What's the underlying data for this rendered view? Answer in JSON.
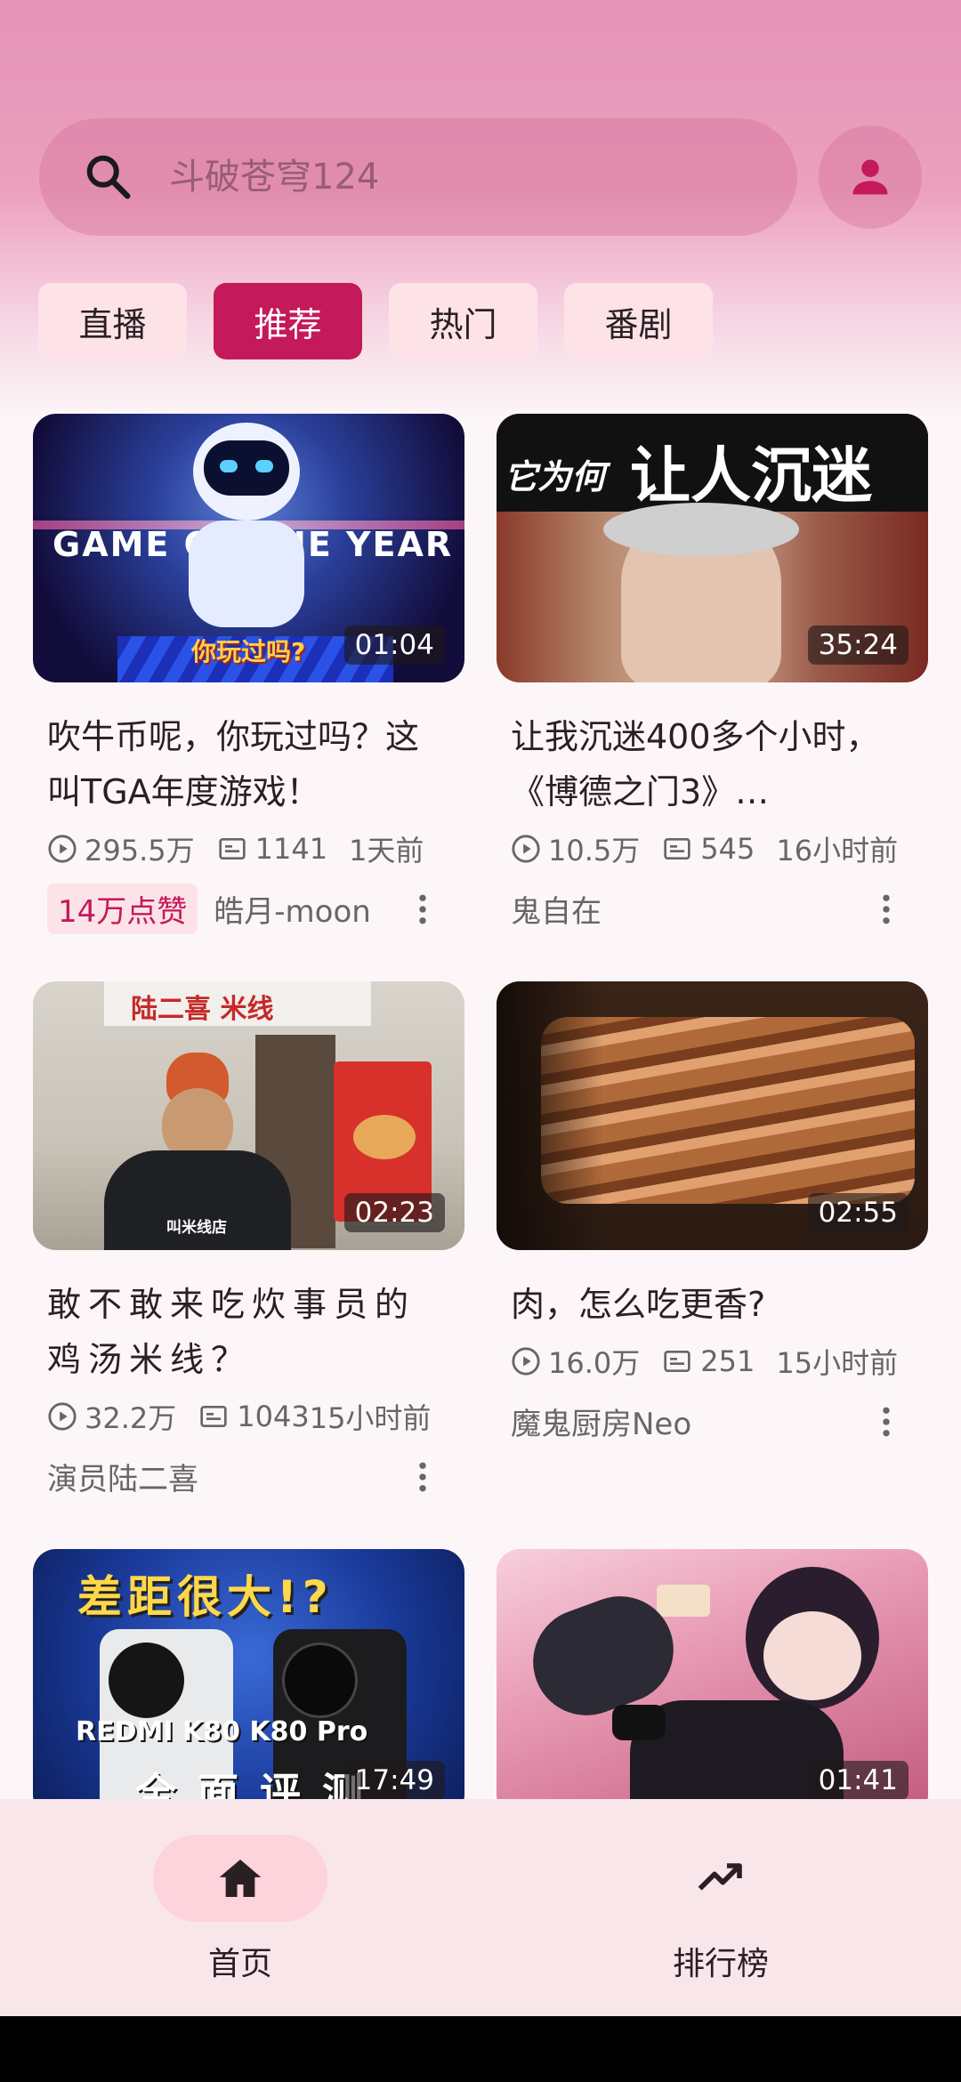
{
  "search": {
    "placeholder": "斗破苍穹124"
  },
  "tabs": [
    {
      "label": "直播",
      "active": false
    },
    {
      "label": "推荐",
      "active": true
    },
    {
      "label": "热门",
      "active": false
    },
    {
      "label": "番剧",
      "active": false
    }
  ],
  "videos": [
    {
      "duration": "01:04",
      "title": "吹牛币呢，你玩过吗？这叫TGA年度游戏！",
      "views": "295.5万",
      "comments": "1141",
      "time": "1天前",
      "badge": "14万点赞",
      "author": "皓月-moon",
      "thumb_text": [
        "GAME OF THE YEAR",
        "你玩过吗?"
      ]
    },
    {
      "duration": "35:24",
      "title": "让我沉迷400多个小时，《博德之门3》…",
      "views": "10.5万",
      "comments": "545",
      "time": "16小时前",
      "author": "鬼自在",
      "thumb_text": [
        "它为何",
        "让人沉迷"
      ]
    },
    {
      "duration": "02:23",
      "title": "敢不敢来吃炊事员的鸡汤米线？",
      "views": "32.2万",
      "comments": "1043",
      "time": "15小时前",
      "author": "演员陆二喜",
      "thumb_text": [
        "陆二喜 米线",
        "叫米线店"
      ]
    },
    {
      "duration": "02:55",
      "title": "肉，怎么吃更香?",
      "views": "16.0万",
      "comments": "251",
      "time": "15小时前",
      "author": "魔鬼厨房Neo"
    },
    {
      "duration": "17:49",
      "thumb_text": [
        "差距很大!?",
        "REDMI K80 K80 Pro",
        "全面评测"
      ]
    },
    {
      "duration": "01:41"
    }
  ],
  "nav": [
    {
      "label": "首页",
      "icon": "home-icon",
      "active": true
    },
    {
      "label": "排行榜",
      "icon": "trending-icon",
      "active": false
    }
  ],
  "colors": {
    "accent": "#c4195a",
    "header": "#e494b5",
    "tab_bg": "#fde3e8"
  }
}
